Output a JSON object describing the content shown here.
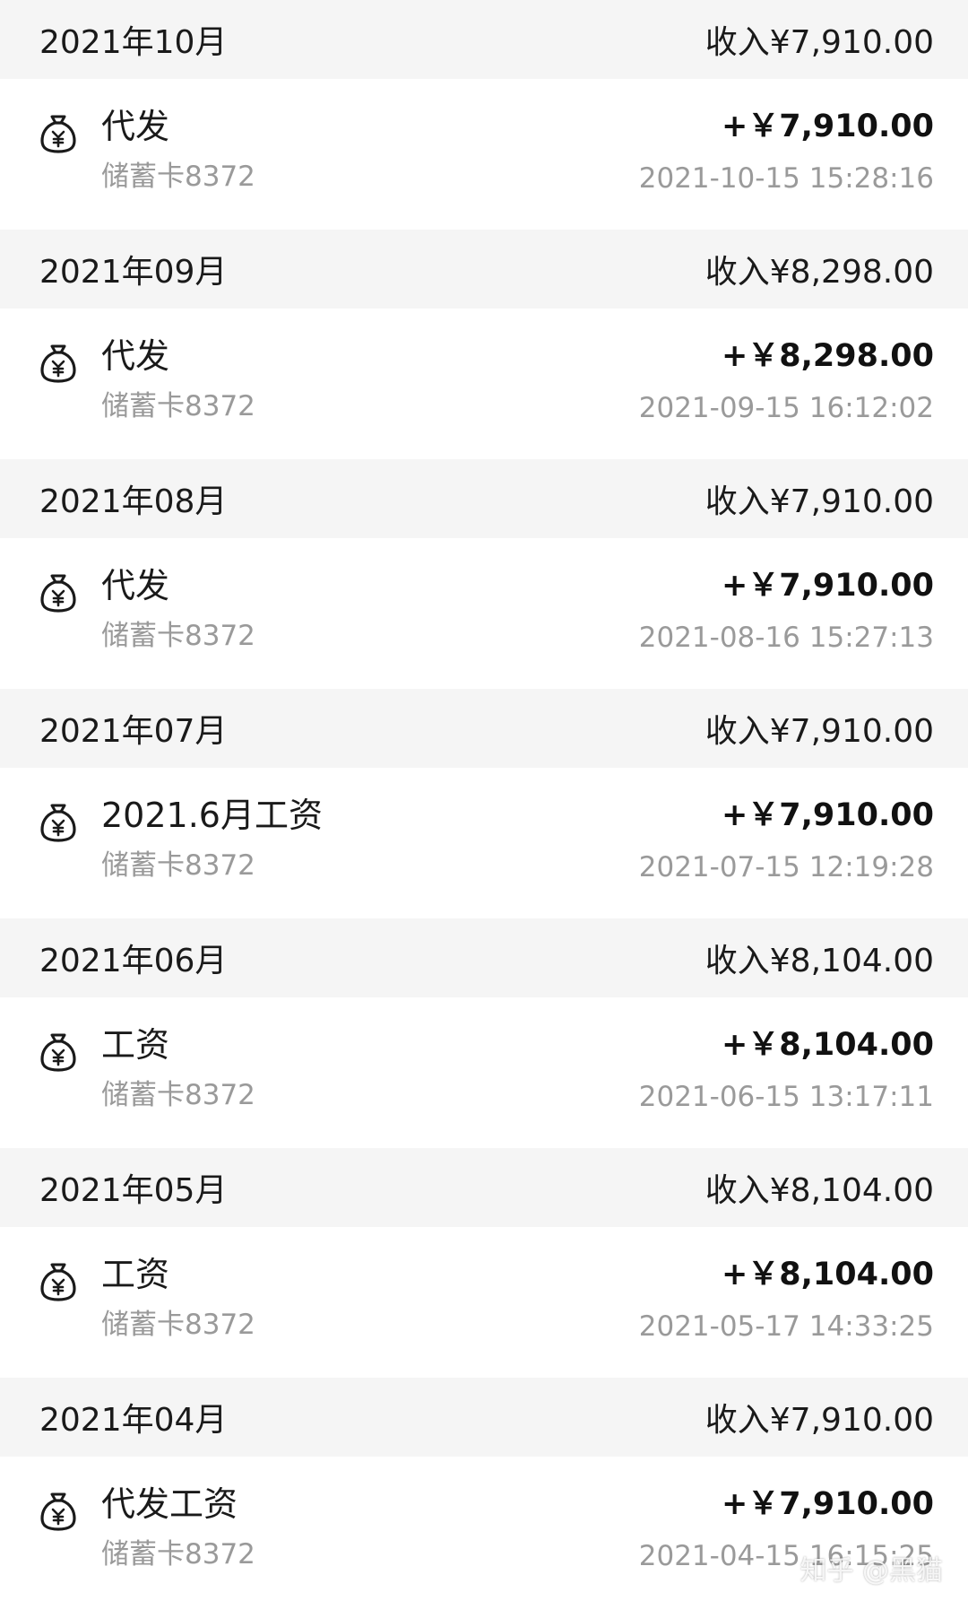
{
  "months": [
    {
      "title": "2021年10月",
      "income": "收入¥7,910.00",
      "transactions": [
        {
          "icon": "money-bag-icon",
          "name": "代发",
          "account": "储蓄卡8372",
          "amount": "+￥7,910.00",
          "time": "2021-10-15 15:28:16"
        }
      ]
    },
    {
      "title": "2021年09月",
      "income": "收入¥8,298.00",
      "transactions": [
        {
          "icon": "money-bag-icon",
          "name": "代发",
          "account": "储蓄卡8372",
          "amount": "+￥8,298.00",
          "time": "2021-09-15 16:12:02"
        }
      ]
    },
    {
      "title": "2021年08月",
      "income": "收入¥7,910.00",
      "transactions": [
        {
          "icon": "money-bag-icon",
          "name": "代发",
          "account": "储蓄卡8372",
          "amount": "+￥7,910.00",
          "time": "2021-08-16 15:27:13"
        }
      ]
    },
    {
      "title": "2021年07月",
      "income": "收入¥7,910.00",
      "transactions": [
        {
          "icon": "money-bag-icon",
          "name": "2021.6月工资",
          "account": "储蓄卡8372",
          "amount": "+￥7,910.00",
          "time": "2021-07-15 12:19:28"
        }
      ]
    },
    {
      "title": "2021年06月",
      "income": "收入¥8,104.00",
      "transactions": [
        {
          "icon": "money-bag-icon",
          "name": "工资",
          "account": "储蓄卡8372",
          "amount": "+￥8,104.00",
          "time": "2021-06-15 13:17:11"
        }
      ]
    },
    {
      "title": "2021年05月",
      "income": "收入¥8,104.00",
      "transactions": [
        {
          "icon": "money-bag-icon",
          "name": "工资",
          "account": "储蓄卡8372",
          "amount": "+￥8,104.00",
          "time": "2021-05-17 14:33:25"
        }
      ]
    },
    {
      "title": "2021年04月",
      "income": "收入¥7,910.00",
      "transactions": [
        {
          "icon": "money-bag-icon",
          "name": "代发工资",
          "account": "储蓄卡8372",
          "amount": "+￥7,910.00",
          "time": "2021-04-15 16:15:25"
        }
      ]
    }
  ],
  "watermark": "知乎 @黑猫",
  "colors": {
    "header_bg": "#f5f5f5",
    "primary_text": "#1a1a1a",
    "secondary_text": "#9a9a9a"
  }
}
